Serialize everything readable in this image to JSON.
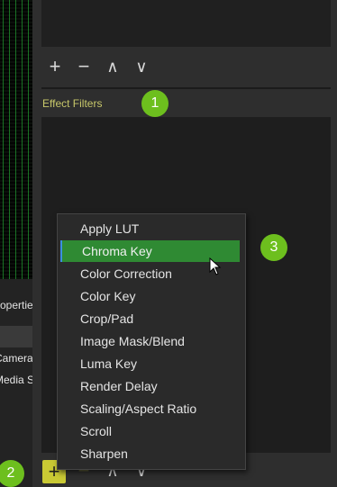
{
  "left": {
    "properties_tab": "Properties",
    "sources": [
      "Camera",
      "Media Source"
    ]
  },
  "top_toolbar": {
    "add": "+",
    "remove": "−",
    "up": "∧",
    "down": "∨"
  },
  "effect_filters": {
    "title": "Effect Filters"
  },
  "bottom_toolbar": {
    "add": "+",
    "remove": "−",
    "up": "∧",
    "down": "∨"
  },
  "badges": [
    "1",
    "2",
    "3"
  ],
  "context_menu": {
    "items": [
      {
        "label": "Apply LUT"
      },
      {
        "label": "Chroma Key",
        "highlighted": true
      },
      {
        "label": "Color Correction"
      },
      {
        "label": "Color Key"
      },
      {
        "label": "Crop/Pad"
      },
      {
        "label": "Image Mask/Blend"
      },
      {
        "label": "Luma Key"
      },
      {
        "label": "Render Delay"
      },
      {
        "label": "Scaling/Aspect Ratio"
      },
      {
        "label": "Scroll"
      },
      {
        "label": "Sharpen"
      }
    ]
  },
  "colors": {
    "badge": "#6dbf1e",
    "highlight": "#2f8a33",
    "accent_title": "#c8c86a"
  }
}
